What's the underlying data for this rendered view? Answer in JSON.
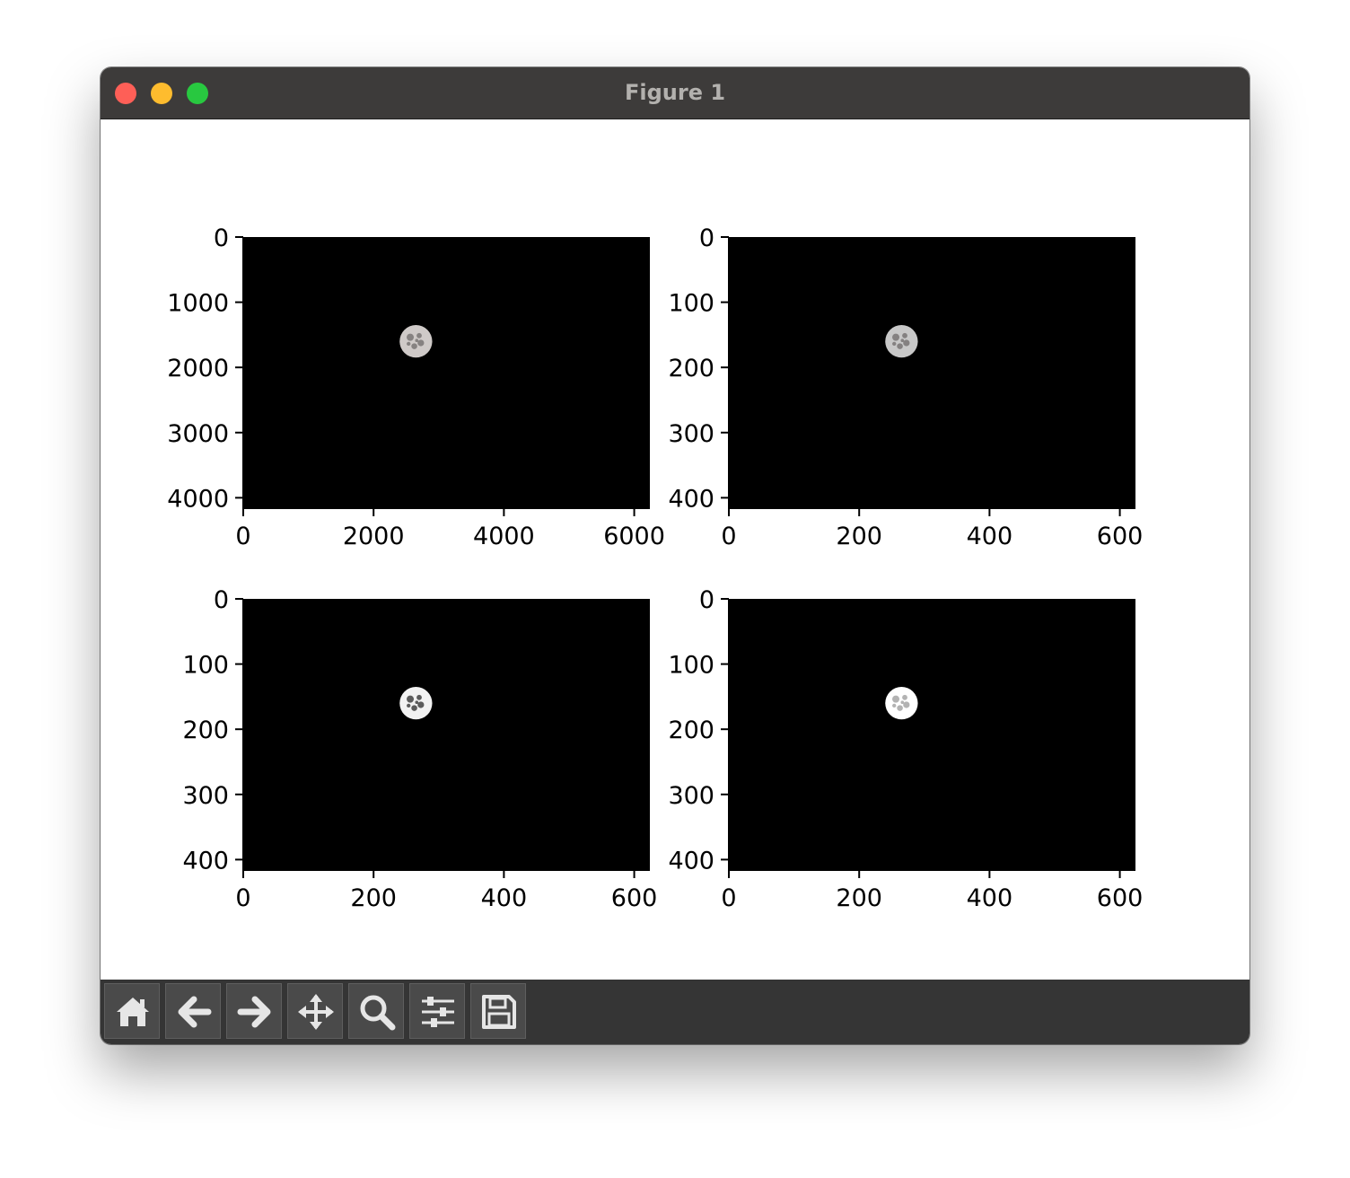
{
  "window": {
    "title": "Figure 1",
    "controls": [
      "close-button",
      "minimize-button",
      "maximize-button"
    ]
  },
  "toolbar": {
    "buttons": [
      {
        "name": "home-button",
        "icon": "home-icon"
      },
      {
        "name": "back-button",
        "icon": "arrow-left-icon"
      },
      {
        "name": "forward-button",
        "icon": "arrow-right-icon"
      },
      {
        "name": "pan-button",
        "icon": "move-icon"
      },
      {
        "name": "zoom-button",
        "icon": "magnifier-icon"
      },
      {
        "name": "configure-subplots-button",
        "icon": "sliders-icon"
      },
      {
        "name": "save-button",
        "icon": "floppy-disk-icon"
      }
    ]
  },
  "colors": {
    "titlebar": "#3d3b3a",
    "toolbar": "#353535",
    "image_background": "#000000",
    "moon": "#d8d8d8"
  },
  "chart_data": [
    {
      "type": "image",
      "title": "",
      "xlabel": "",
      "ylabel": "",
      "xlim": [
        0,
        6240
      ],
      "ylim": [
        4160,
        0
      ],
      "xticks": [
        0,
        2000,
        4000,
        6000
      ],
      "yticks": [
        0,
        1000,
        2000,
        3000,
        4000
      ],
      "moon_center": [
        2650,
        1600
      ],
      "moon_radius": 250,
      "moon_style": "color"
    },
    {
      "type": "image",
      "title": "",
      "xlabel": "",
      "ylabel": "",
      "xlim": [
        0,
        624
      ],
      "ylim": [
        416,
        0
      ],
      "xticks": [
        0,
        200,
        400,
        600
      ],
      "yticks": [
        0,
        100,
        200,
        300,
        400
      ],
      "moon_center": [
        265,
        160
      ],
      "moon_radius": 25,
      "moon_style": "grayscale"
    },
    {
      "type": "image",
      "title": "",
      "xlabel": "",
      "ylabel": "",
      "xlim": [
        0,
        624
      ],
      "ylim": [
        416,
        0
      ],
      "xticks": [
        0,
        200,
        400,
        600
      ],
      "yticks": [
        0,
        100,
        200,
        300,
        400
      ],
      "moon_center": [
        265,
        160
      ],
      "moon_radius": 25,
      "moon_style": "threshold"
    },
    {
      "type": "image",
      "title": "",
      "xlabel": "",
      "ylabel": "",
      "xlim": [
        0,
        624
      ],
      "ylim": [
        416,
        0
      ],
      "xticks": [
        0,
        200,
        400,
        600
      ],
      "yticks": [
        0,
        100,
        200,
        300,
        400
      ],
      "moon_center": [
        265,
        160
      ],
      "moon_radius": 25,
      "moon_style": "bright"
    }
  ]
}
